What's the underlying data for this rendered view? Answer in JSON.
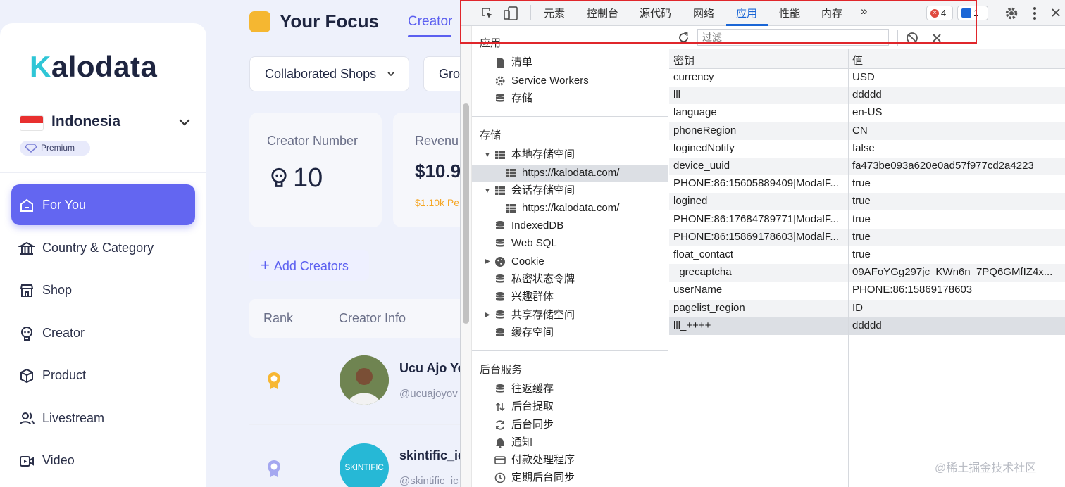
{
  "sidebar": {
    "logo_k": "K",
    "logo_rest": "alodata",
    "country": "Indonesia",
    "premium": "Premium",
    "items": [
      {
        "label": "For You",
        "icon": "home-icon",
        "active": true
      },
      {
        "label": "Country & Category",
        "icon": "bank-icon"
      },
      {
        "label": "Shop",
        "icon": "store-icon"
      },
      {
        "label": "Creator",
        "icon": "creator-icon"
      },
      {
        "label": "Product",
        "icon": "box-icon"
      },
      {
        "label": "Livestream",
        "icon": "people-icon"
      },
      {
        "label": "Video",
        "icon": "video-icon"
      }
    ]
  },
  "main": {
    "title": "Your Focus",
    "tab": "Creator",
    "select1": "Collaborated Shops",
    "select2": "Gro",
    "card1": {
      "label": "Creator Number",
      "value": "10"
    },
    "card2": {
      "label": "Revenu",
      "value": "$10.9",
      "sub": "$1.10k Pe"
    },
    "add_button": "Add Creators",
    "table": {
      "col_rank": "Rank",
      "col_info": "Creator Info",
      "rows": [
        {
          "name": "Ucu Ajo Yo",
          "handle": "@ucuajoyov"
        },
        {
          "name": "skintific_ic",
          "handle": "@skintific_ic",
          "avatar_text": "SKINTIFIC"
        }
      ]
    }
  },
  "devtools": {
    "tabs": [
      "元素",
      "控制台",
      "源代码",
      "网络",
      "应用",
      "性能",
      "内存"
    ],
    "active_tab": "应用",
    "more": "»",
    "errors": "4",
    "messages": "1",
    "left": {
      "app_section": "应用",
      "app_items": [
        "清单",
        "Service Workers",
        "存储"
      ],
      "storage_section": "存储",
      "local_storage": "本地存储空间",
      "local_origin": "https://kalodata.com/",
      "session_storage": "会话存储空间",
      "session_origin": "https://kalodata.com/",
      "indexeddb": "IndexedDB",
      "websql": "Web SQL",
      "cookie": "Cookie",
      "private_token": "私密状态令牌",
      "interest_groups": "兴趣群体",
      "shared_storage": "共享存储空间",
      "cache_storage": "缓存空间",
      "bg_section": "后台服务",
      "bg_items": [
        "往返缓存",
        "后台提取",
        "后台同步",
        "通知",
        "付款处理程序",
        "定期后台同步"
      ]
    },
    "filter_placeholder": "过滤",
    "kv_header": {
      "key": "密钥",
      "value": "值"
    },
    "kv_rows": [
      {
        "k": "currency",
        "v": "USD"
      },
      {
        "k": "lll",
        "v": "ddddd"
      },
      {
        "k": "language",
        "v": "en-US"
      },
      {
        "k": "phoneRegion",
        "v": "CN"
      },
      {
        "k": "loginedNotify",
        "v": "false"
      },
      {
        "k": "device_uuid",
        "v": "fa473be093a620e0ad57f977cd2a4223"
      },
      {
        "k": "PHONE:86:15605889409|ModalF...",
        "v": "true"
      },
      {
        "k": "logined",
        "v": "true"
      },
      {
        "k": "PHONE:86:17684789771|ModalF...",
        "v": "true"
      },
      {
        "k": "PHONE:86:15869178603|ModalF...",
        "v": "true"
      },
      {
        "k": "float_contact",
        "v": "true"
      },
      {
        "k": "_grecaptcha",
        "v": "09AFoYGg297jc_KWn6n_7PQ6GMfIZ4x..."
      },
      {
        "k": "userName",
        "v": "PHONE:86:15869178603"
      },
      {
        "k": "pagelist_region",
        "v": "ID"
      },
      {
        "k": "lll_++++",
        "v": "ddddd"
      }
    ]
  },
  "watermark": "@稀土掘金技术社区",
  "colors": {
    "accent": "#6366f1",
    "devtools_active": "#1a66d6",
    "highlight_frame": "#e0262b"
  }
}
